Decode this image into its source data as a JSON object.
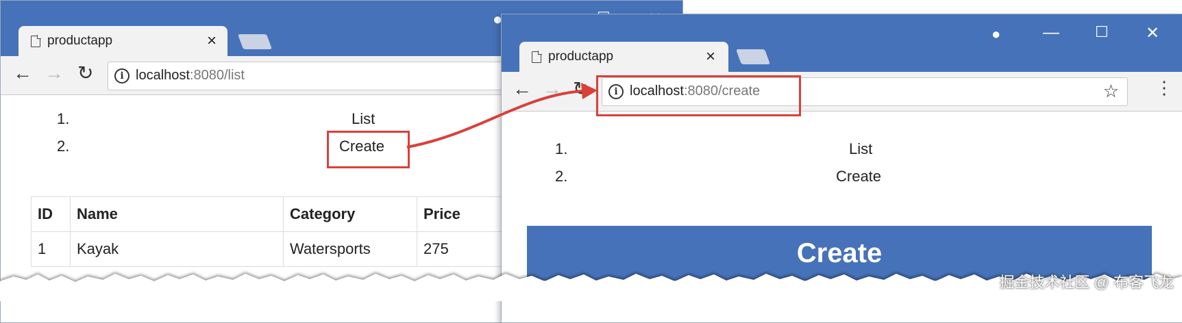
{
  "window1": {
    "tab_title": "productapp",
    "tab_close": "×",
    "url_host": "localhost",
    "url_rest": ":8080/list",
    "nav": [
      {
        "number": "1.",
        "label": "List"
      },
      {
        "number": "2.",
        "label": "Create"
      }
    ],
    "table": {
      "headers": [
        "ID",
        "Name",
        "Category",
        "Price"
      ],
      "rows": [
        [
          "1",
          "Kayak",
          "Watersports",
          "275"
        ]
      ]
    }
  },
  "window2": {
    "tab_title": "productapp",
    "tab_close": "×",
    "url_host": "localhost",
    "url_rest": ":8080/create",
    "nav": [
      {
        "number": "1.",
        "label": "List"
      },
      {
        "number": "2.",
        "label": "Create"
      }
    ],
    "banner": "Create"
  },
  "controls": {
    "back": "←",
    "forward": "→",
    "reload": "↻",
    "minimize": "—",
    "maximize": "☐",
    "close": "✕",
    "star": "☆",
    "menu": "⋮",
    "account": "●",
    "info": "i"
  },
  "watermark": "掘金技术社区 @ 布客飞龙",
  "colors": {
    "titlebar": "#4672b9",
    "highlight": "#d9403a",
    "banner": "#4672b9"
  }
}
